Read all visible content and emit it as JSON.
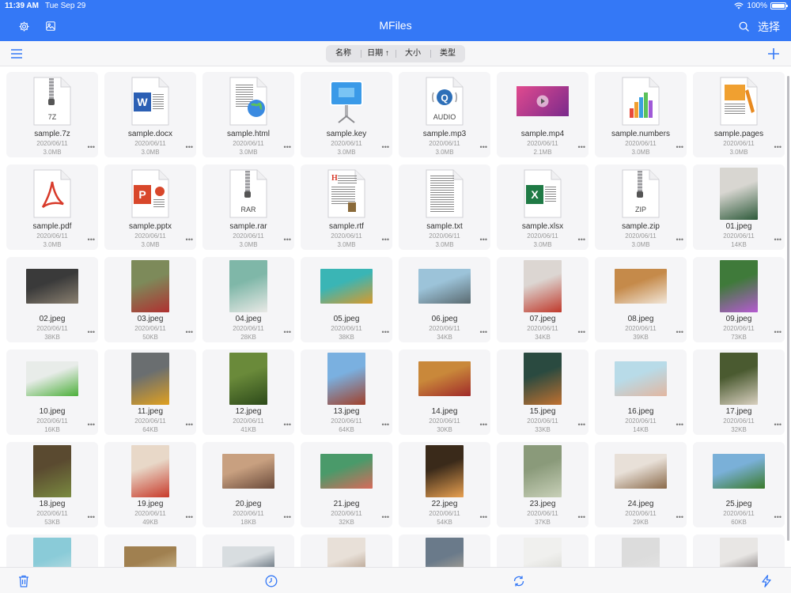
{
  "status": {
    "time": "11:39 AM",
    "date": "Tue Sep 29",
    "battery": "100%",
    "battery_level": 1.0
  },
  "nav": {
    "title": "MFiles",
    "select_label": "选择",
    "icons": [
      "gear-icon",
      "image-icon",
      "search-icon"
    ]
  },
  "sort": {
    "options": [
      "名称",
      "日期 ↑",
      "大小",
      "类型"
    ],
    "icons": [
      "list-icon",
      "plus-icon"
    ]
  },
  "toolbar": {
    "icons": [
      "trash-icon",
      "clock-icon",
      "refresh-icon",
      "bolt-icon"
    ]
  },
  "colors": {
    "accent": "#3478f6"
  },
  "files": [
    {
      "name": "sample.7z",
      "date": "2020/06/11",
      "size": "3.0MB",
      "icon": "zipper-doc",
      "ext": "7Z"
    },
    {
      "name": "sample.docx",
      "date": "2020/06/11",
      "size": "3.0MB",
      "icon": "word-doc",
      "ext": ""
    },
    {
      "name": "sample.html",
      "date": "2020/06/11",
      "size": "3.0MB",
      "icon": "html-doc",
      "ext": ""
    },
    {
      "name": "sample.key",
      "date": "2020/06/11",
      "size": "3.0MB",
      "icon": "keynote-doc",
      "ext": ""
    },
    {
      "name": "sample.mp3",
      "date": "2020/06/11",
      "size": "3.0MB",
      "icon": "audio-doc",
      "ext": "AUDIO"
    },
    {
      "name": "sample.mp4",
      "date": "2020/06/11",
      "size": "2.1MB",
      "icon": "video-thumb",
      "ext": "",
      "c1": "#e14a8e",
      "c2": "#7a2a8c"
    },
    {
      "name": "sample.numbers",
      "date": "2020/06/11",
      "size": "3.0MB",
      "icon": "numbers-doc",
      "ext": ""
    },
    {
      "name": "sample.pages",
      "date": "2020/06/11",
      "size": "3.0MB",
      "icon": "pages-doc",
      "ext": ""
    },
    {
      "name": "sample.pdf",
      "date": "2020/06/11",
      "size": "3.0MB",
      "icon": "pdf-doc",
      "ext": ""
    },
    {
      "name": "sample.pptx",
      "date": "2020/06/11",
      "size": "3.0MB",
      "icon": "ppt-doc",
      "ext": ""
    },
    {
      "name": "sample.rar",
      "date": "2020/06/11",
      "size": "3.0MB",
      "icon": "zipper-doc",
      "ext": "RAR"
    },
    {
      "name": "sample.rtf",
      "date": "2020/06/11",
      "size": "3.0MB",
      "icon": "rtf-doc",
      "ext": ""
    },
    {
      "name": "sample.txt",
      "date": "2020/06/11",
      "size": "3.0MB",
      "icon": "text-doc",
      "ext": ""
    },
    {
      "name": "sample.xlsx",
      "date": "2020/06/11",
      "size": "3.0MB",
      "icon": "excel-doc",
      "ext": ""
    },
    {
      "name": "sample.zip",
      "date": "2020/06/11",
      "size": "3.0MB",
      "icon": "zipper-doc",
      "ext": "ZIP"
    },
    {
      "name": "01.jpeg",
      "date": "2020/06/11",
      "size": "14KB",
      "icon": "photo",
      "orient": "tall",
      "c1": "#d8d6d1",
      "c2": "#2d5a3a"
    },
    {
      "name": "02.jpeg",
      "date": "2020/06/11",
      "size": "38KB",
      "icon": "photo",
      "orient": "wide",
      "c1": "#3a3a3a",
      "c2": "#8a8070"
    },
    {
      "name": "03.jpeg",
      "date": "2020/06/11",
      "size": "50KB",
      "icon": "photo",
      "orient": "tall",
      "c1": "#7d8a5a",
      "c2": "#b03030"
    },
    {
      "name": "04.jpeg",
      "date": "2020/06/11",
      "size": "28KB",
      "icon": "photo",
      "orient": "tall",
      "c1": "#7fb7a8",
      "c2": "#e9e9e6"
    },
    {
      "name": "05.jpeg",
      "date": "2020/06/11",
      "size": "38KB",
      "icon": "photo",
      "orient": "wide",
      "c1": "#3ab5b5",
      "c2": "#d99a2b"
    },
    {
      "name": "06.jpeg",
      "date": "2020/06/11",
      "size": "34KB",
      "icon": "photo",
      "orient": "wide",
      "c1": "#9cc3d9",
      "c2": "#5a6a70"
    },
    {
      "name": "07.jpeg",
      "date": "2020/06/11",
      "size": "34KB",
      "icon": "photo",
      "orient": "tall",
      "c1": "#dcd6d2",
      "c2": "#c0392b"
    },
    {
      "name": "08.jpeg",
      "date": "2020/06/11",
      "size": "39KB",
      "icon": "photo",
      "orient": "wide",
      "c1": "#c58a4a",
      "c2": "#f1e6d8"
    },
    {
      "name": "09.jpeg",
      "date": "2020/06/11",
      "size": "73KB",
      "icon": "photo",
      "orient": "tall",
      "c1": "#3f7a3a",
      "c2": "#b65ad2"
    },
    {
      "name": "10.jpeg",
      "date": "2020/06/11",
      "size": "16KB",
      "icon": "photo",
      "orient": "wide",
      "c1": "#e8ece9",
      "c2": "#4caf3a"
    },
    {
      "name": "11.jpeg",
      "date": "2020/06/11",
      "size": "64KB",
      "icon": "photo",
      "orient": "tall",
      "c1": "#6a6e70",
      "c2": "#e0a020"
    },
    {
      "name": "12.jpeg",
      "date": "2020/06/11",
      "size": "41KB",
      "icon": "photo",
      "orient": "tall",
      "c1": "#6a8a3a",
      "c2": "#2d4a1a"
    },
    {
      "name": "13.jpeg",
      "date": "2020/06/11",
      "size": "64KB",
      "icon": "photo",
      "orient": "tall",
      "c1": "#7ab0e0",
      "c2": "#a0402a"
    },
    {
      "name": "14.jpeg",
      "date": "2020/06/11",
      "size": "30KB",
      "icon": "photo",
      "orient": "wide",
      "c1": "#c9883a",
      "c2": "#a02a2a"
    },
    {
      "name": "15.jpeg",
      "date": "2020/06/11",
      "size": "33KB",
      "icon": "photo",
      "orient": "tall",
      "c1": "#2a4a40",
      "c2": "#c07030"
    },
    {
      "name": "16.jpeg",
      "date": "2020/06/11",
      "size": "14KB",
      "icon": "photo",
      "orient": "wide",
      "c1": "#b8dbe8",
      "c2": "#e2b6a0"
    },
    {
      "name": "17.jpeg",
      "date": "2020/06/11",
      "size": "32KB",
      "icon": "photo",
      "orient": "tall",
      "c1": "#4a5a30",
      "c2": "#d9d0c0"
    },
    {
      "name": "18.jpeg",
      "date": "2020/06/11",
      "size": "53KB",
      "icon": "photo",
      "orient": "tall",
      "c1": "#5a4a30",
      "c2": "#7a8a40"
    },
    {
      "name": "19.jpeg",
      "date": "2020/06/11",
      "size": "49KB",
      "icon": "photo",
      "orient": "tall",
      "c1": "#e8d8c8",
      "c2": "#c83a2a"
    },
    {
      "name": "20.jpeg",
      "date": "2020/06/11",
      "size": "18KB",
      "icon": "photo",
      "orient": "wide",
      "c1": "#c8a080",
      "c2": "#6a4a3a"
    },
    {
      "name": "21.jpeg",
      "date": "2020/06/11",
      "size": "32KB",
      "icon": "photo",
      "orient": "wide",
      "c1": "#4a9a6a",
      "c2": "#d86a5a"
    },
    {
      "name": "22.jpeg",
      "date": "2020/06/11",
      "size": "54KB",
      "icon": "photo",
      "orient": "tall",
      "c1": "#3a2a1a",
      "c2": "#e8a050"
    },
    {
      "name": "23.jpeg",
      "date": "2020/06/11",
      "size": "37KB",
      "icon": "photo",
      "orient": "tall",
      "c1": "#8a9a7a",
      "c2": "#c8d0b8"
    },
    {
      "name": "24.jpeg",
      "date": "2020/06/11",
      "size": "29KB",
      "icon": "photo",
      "orient": "wide",
      "c1": "#e8e0d8",
      "c2": "#8a6a4a"
    },
    {
      "name": "25.jpeg",
      "date": "2020/06/11",
      "size": "60KB",
      "icon": "photo",
      "orient": "wide",
      "c1": "#7ab0d8",
      "c2": "#3a7a2a"
    },
    {
      "name": "",
      "date": "",
      "size": "",
      "icon": "photo",
      "orient": "tall",
      "c1": "#8acbd8",
      "c2": "#d8e8e8"
    },
    {
      "name": "",
      "date": "",
      "size": "",
      "icon": "photo",
      "orient": "wide",
      "c1": "#a08050",
      "c2": "#d8c8a0"
    },
    {
      "name": "",
      "date": "",
      "size": "",
      "icon": "photo",
      "orient": "wide",
      "c1": "#d8dde0",
      "c2": "#2a3a4a"
    },
    {
      "name": "",
      "date": "",
      "size": "",
      "icon": "photo",
      "orient": "tall",
      "c1": "#e8e0d8",
      "c2": "#8a6a50"
    },
    {
      "name": "",
      "date": "",
      "size": "",
      "icon": "photo",
      "orient": "tall",
      "c1": "#6a7a8a",
      "c2": "#d8c0a0"
    },
    {
      "name": "",
      "date": "",
      "size": "",
      "icon": "photo",
      "orient": "tall",
      "c1": "#f0f0ee",
      "c2": "#c8c8c0"
    },
    {
      "name": "",
      "date": "",
      "size": "",
      "icon": "photo",
      "orient": "tall",
      "c1": "#dcdcdc",
      "c2": "#e8e8e8"
    },
    {
      "name": "",
      "date": "",
      "size": "",
      "icon": "photo",
      "orient": "tall",
      "c1": "#e8e6e4",
      "c2": "#3a3030"
    }
  ]
}
